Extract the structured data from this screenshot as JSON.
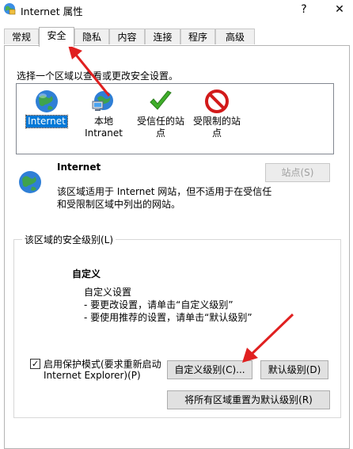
{
  "window": {
    "title": "Internet 属性",
    "help_label": "?",
    "close_label": "✕"
  },
  "tabs": [
    {
      "label": "常规",
      "active": false
    },
    {
      "label": "安全",
      "active": true
    },
    {
      "label": "隐私",
      "active": false
    },
    {
      "label": "内容",
      "active": false
    },
    {
      "label": "连接",
      "active": false
    },
    {
      "label": "程序",
      "active": false
    },
    {
      "label": "高级",
      "active": false
    }
  ],
  "security": {
    "zone_prompt": "选择一个区域以查看或更改安全设置。",
    "zones": [
      {
        "line1": "Internet",
        "line2": "",
        "icon": "globe-icon",
        "selected": true
      },
      {
        "line1": "本地",
        "line2": "Intranet",
        "icon": "intranet-icon",
        "selected": false
      },
      {
        "line1": "受信任的站",
        "line2": "点",
        "icon": "checkmark-icon",
        "selected": false
      },
      {
        "line1": "受限制的站",
        "line2": "点",
        "icon": "no-entry-icon",
        "selected": false
      }
    ],
    "zone_info": {
      "name": "Internet",
      "description_line1": "该区域适用于 Internet 网站，但不适用于在受信任",
      "description_line2": "和受限制区域中列出的网站。",
      "sites_button": "站点(S)"
    },
    "level_group": {
      "legend": "该区域的安全级别(L)",
      "level_name": "自定义",
      "setting_title": "自定义设置",
      "hint1": "- 要更改设置，请单击“自定义级别”",
      "hint2": "- 要使用推荐的设置，请单击“默认级别”",
      "protected_mode_line1": "启用保护模式(要求重新启动",
      "protected_mode_line2": "Internet Explorer)(P)",
      "protected_mode_checked": "✓",
      "custom_level_button": "自定义级别(C)...",
      "default_level_button": "默认级别(D)"
    },
    "reset_all_button": "将所有区域重置为默认级别(R)"
  },
  "colors": {
    "accent": "#0078d7",
    "annotation_arrow": "#e02020"
  }
}
